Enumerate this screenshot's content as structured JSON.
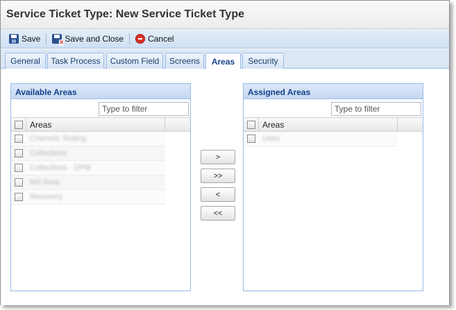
{
  "window": {
    "title": "Service Ticket Type: New Service Ticket Type"
  },
  "toolbar": {
    "save_label": "Save",
    "save_close_label": "Save and Close",
    "cancel_label": "Cancel"
  },
  "tabs": [
    {
      "label": "General"
    },
    {
      "label": "Task Process"
    },
    {
      "label": "Custom Field"
    },
    {
      "label": "Screens"
    },
    {
      "label": "Areas",
      "active": true
    },
    {
      "label": "Security"
    }
  ],
  "available_areas": {
    "title": "Available Areas",
    "filter_placeholder": "Type to filter",
    "column_header": "Areas",
    "rows": [
      "Chamois Testing",
      "Collections",
      "Collections - DPM",
      "MS Area",
      "Recovery"
    ]
  },
  "assigned_areas": {
    "title": "Assigned Areas",
    "filter_placeholder": "Type to filter",
    "column_header": "Areas",
    "rows": [
      "Uses"
    ]
  },
  "move_buttons": {
    "add_one": ">",
    "add_all": ">>",
    "remove_one": "<",
    "remove_all": "<<"
  },
  "icons": {
    "save": "floppy-disk-icon",
    "save_close": "floppy-disk-close-icon",
    "cancel": "cancel-circle-icon"
  }
}
